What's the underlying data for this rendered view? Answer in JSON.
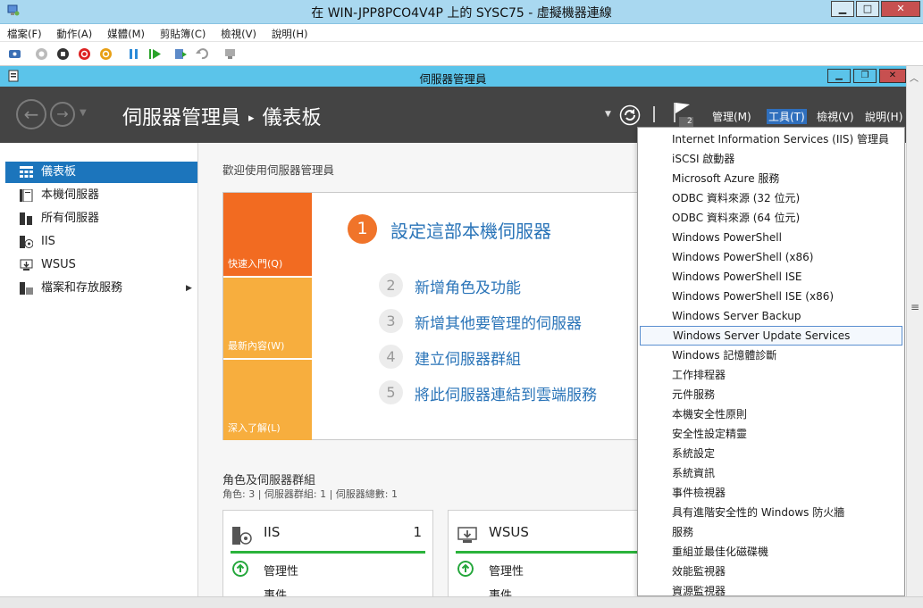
{
  "vm": {
    "title": "在 WIN-JPP8PCO4V4P 上的 SYSC75 - 虛擬機器連線",
    "menu": [
      "檔案(F)",
      "動作(A)",
      "媒體(M)",
      "剪貼簿(C)",
      "檢視(V)",
      "說明(H)"
    ]
  },
  "app": {
    "title": "伺服器管理員",
    "breadcrumb_root": "伺服器管理員",
    "breadcrumb_sep": "▸",
    "breadcrumb_current": "儀表板",
    "header_menu": {
      "manage": "管理(M)",
      "tools": "工具(T)",
      "view": "檢視(V)",
      "help": "說明(H)"
    },
    "notification_count": "2"
  },
  "sidebar": {
    "items": [
      {
        "label": "儀表板",
        "icon": "dashboard-icon",
        "active": true
      },
      {
        "label": "本機伺服器",
        "icon": "server-icon"
      },
      {
        "label": "所有伺服器",
        "icon": "servers-icon"
      },
      {
        "label": "IIS",
        "icon": "iis-icon"
      },
      {
        "label": "WSUS",
        "icon": "wsus-icon"
      },
      {
        "label": "檔案和存放服務",
        "icon": "file-storage-icon",
        "expandable": true
      }
    ]
  },
  "welcome": {
    "heading": "歡迎使用伺服器管理員",
    "quick_start": "快速入門(Q)",
    "whats_new": "最新內容(W)",
    "learn_more": "深入了解(L)",
    "steps": [
      {
        "num": "1",
        "label": "設定這部本機伺服器"
      },
      {
        "num": "2",
        "label": "新增角色及功能"
      },
      {
        "num": "3",
        "label": "新增其他要管理的伺服器"
      },
      {
        "num": "4",
        "label": "建立伺服器群組"
      },
      {
        "num": "5",
        "label": "將此伺服器連結到雲端服務"
      }
    ]
  },
  "roles": {
    "title": "角色及伺服器群組",
    "subtitle": "角色: 3 | 伺服器群組: 1 | 伺服器總數: 1",
    "tiles": [
      {
        "name": "IIS",
        "count": "1",
        "status": "管理性",
        "events": "事件"
      },
      {
        "name": "WSUS",
        "count": "",
        "status": "管理性",
        "events": "事件"
      }
    ]
  },
  "tools_menu": {
    "highlighted": "Windows Server Update Services",
    "items": [
      "Internet Information Services (IIS) 管理員",
      "iSCSI 啟動器",
      "Microsoft Azure 服務",
      "ODBC 資料來源 (32 位元)",
      "ODBC 資料來源 (64 位元)",
      "Windows PowerShell",
      "Windows PowerShell (x86)",
      "Windows PowerShell ISE",
      "Windows PowerShell ISE (x86)",
      "Windows Server Backup",
      "Windows Server Update Services",
      "Windows 記憶體診斷",
      "工作排程器",
      "元件服務",
      "本機安全性原則",
      "安全性設定精靈",
      "系統設定",
      "系統資訊",
      "事件檢視器",
      "具有進階安全性的 Windows 防火牆",
      "服務",
      "重組並最佳化磁碟機",
      "效能監視器",
      "資源監視器"
    ]
  },
  "colors": {
    "accent": "#1c75bc",
    "header_bg": "#444444",
    "quickstart_orange": "#f26b21",
    "tile_orange": "#f7ae3e",
    "link_blue": "#2a74b8",
    "ok_green": "#2bb33b"
  }
}
